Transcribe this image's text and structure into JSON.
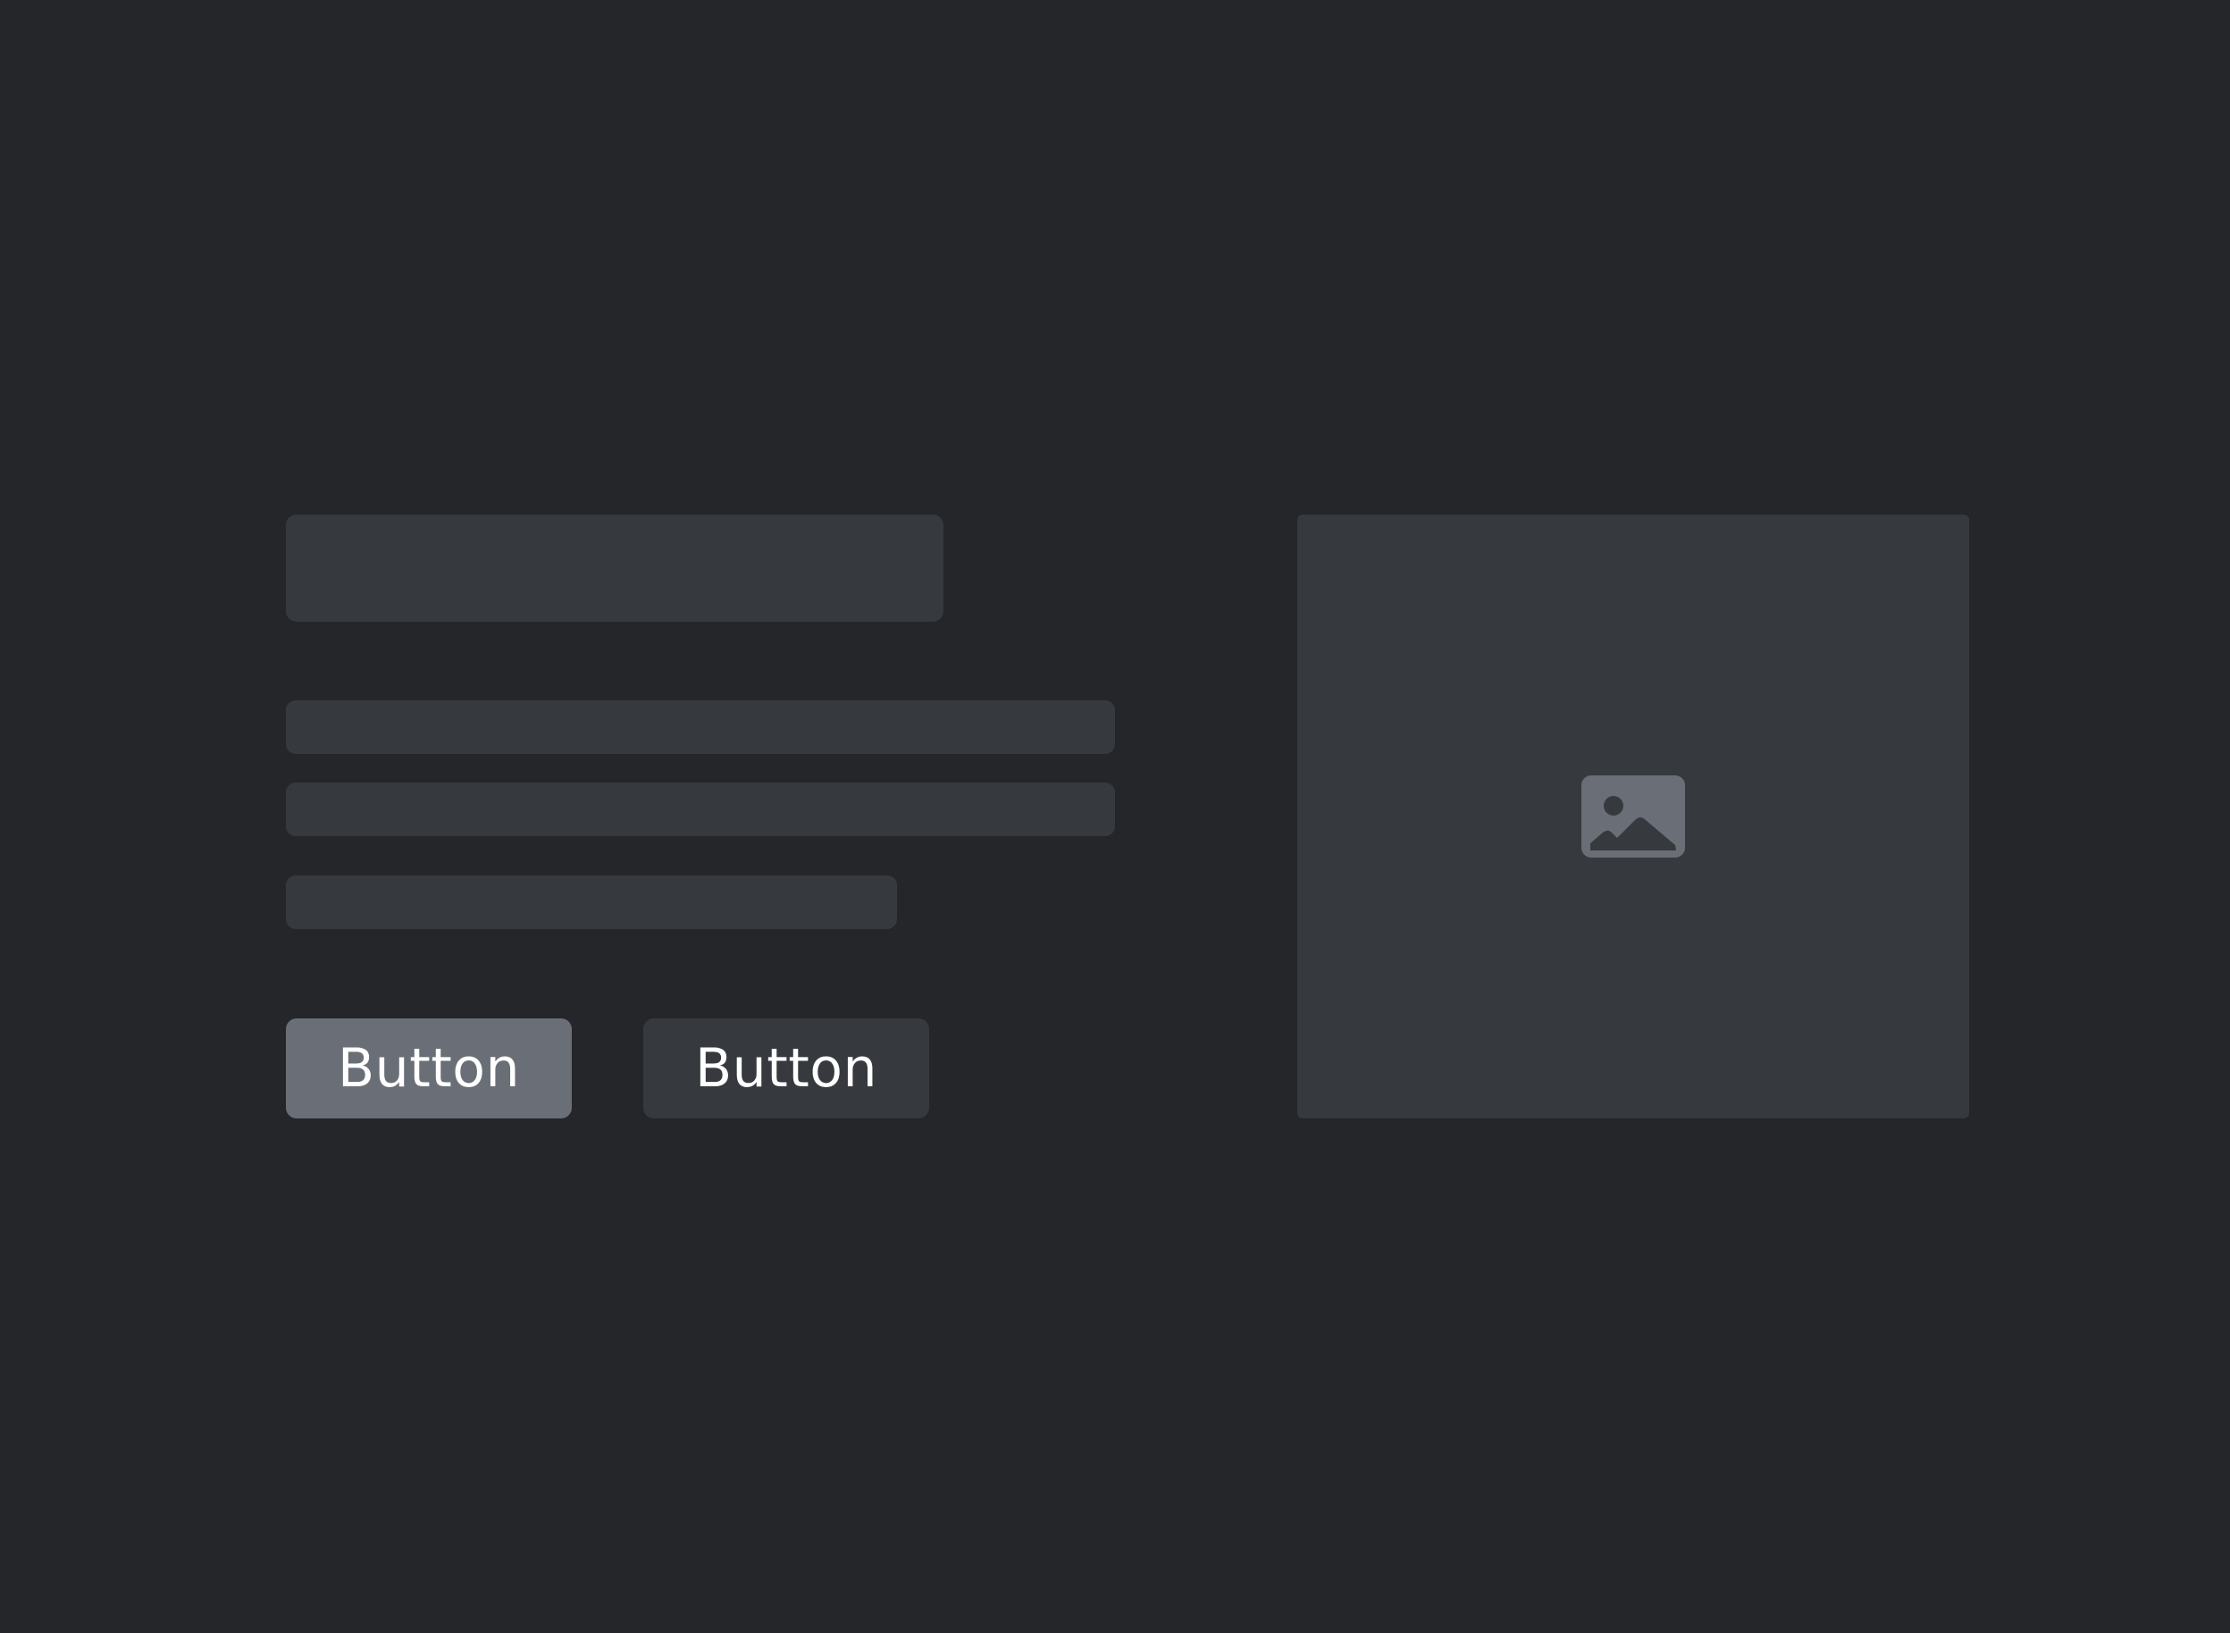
{
  "colors": {
    "background": "#25262a",
    "placeholder": "#363a3e",
    "primary_button": "#6a6e76",
    "secondary_button": "#363a3e",
    "button_text": "#ffffff",
    "icon": "#6a6e76"
  },
  "actions": {
    "primary_label": "Button",
    "secondary_label": "Button"
  },
  "media": {
    "icon": "image-icon"
  }
}
